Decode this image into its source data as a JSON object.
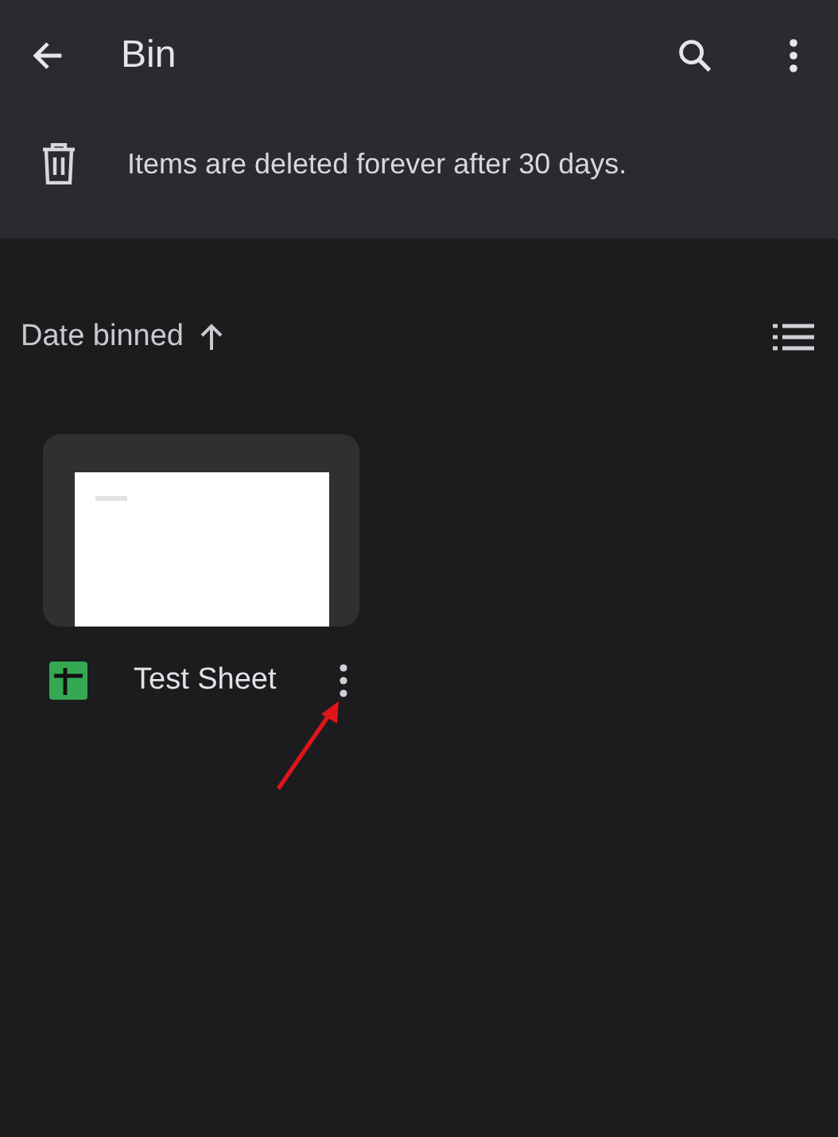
{
  "app_bar": {
    "title": "Bin"
  },
  "notice": {
    "text": "Items are deleted forever after 30 days."
  },
  "sort": {
    "label": "Date binned"
  },
  "files": [
    {
      "name": "Test Sheet",
      "kind": "sheet"
    }
  ]
}
